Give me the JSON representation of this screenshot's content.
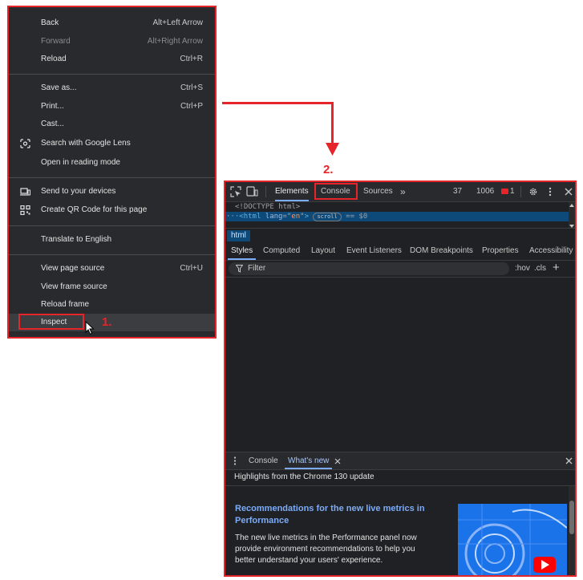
{
  "context_menu": {
    "groups": [
      [
        {
          "label": "Back",
          "shortcut": "Alt+Left Arrow",
          "disabled": false
        },
        {
          "label": "Forward",
          "shortcut": "Alt+Right Arrow",
          "disabled": true
        },
        {
          "label": "Reload",
          "shortcut": "Ctrl+R",
          "disabled": false
        }
      ],
      [
        {
          "label": "Save as...",
          "shortcut": "Ctrl+S",
          "disabled": false
        },
        {
          "label": "Print...",
          "shortcut": "Ctrl+P",
          "disabled": false
        },
        {
          "label": "Cast...",
          "shortcut": "",
          "disabled": false
        },
        {
          "label": "Search with Google Lens",
          "shortcut": "",
          "icon": "google-lens-icon"
        },
        {
          "label": "Open in reading mode",
          "shortcut": ""
        }
      ],
      [
        {
          "label": "Send to your devices",
          "shortcut": "",
          "icon": "devices-icon"
        },
        {
          "label": "Create QR Code for this page",
          "shortcut": "",
          "icon": "qr-code-icon"
        }
      ],
      [
        {
          "label": "Translate to English",
          "shortcut": ""
        }
      ],
      [
        {
          "label": "View page source",
          "shortcut": "Ctrl+U"
        },
        {
          "label": "View frame source",
          "shortcut": ""
        },
        {
          "label": "Reload frame",
          "shortcut": ""
        },
        {
          "label": "Inspect",
          "shortcut": "",
          "highlighted": true
        }
      ]
    ]
  },
  "annotations": {
    "step1": "1.",
    "step2": "2."
  },
  "devtools": {
    "toolbar": {
      "tabs": [
        "Elements",
        "Console",
        "Sources"
      ],
      "more": "»",
      "warnings": "37",
      "messages": "1006",
      "errors": "1"
    },
    "dom": {
      "doctype": "<!DOCTYPE html>",
      "html_tag": "html",
      "lang_attr": "lang",
      "lang_value": "\"en\"",
      "scroll_badge": "scroll",
      "selection": "== $0"
    },
    "breadcrumb": "html",
    "styles_tabs": [
      "Styles",
      "Computed",
      "Layout",
      "Event Listeners",
      "DOM Breakpoints",
      "Properties",
      "Accessibility"
    ],
    "filter": {
      "placeholder": "Filter",
      "hov": ":hov",
      "cls": ".cls",
      "plus": "+"
    },
    "drawer": {
      "tabs": [
        "Console",
        "What's new"
      ],
      "highlights": "Highlights from the Chrome 130 update",
      "title": "Recommendations for the new live metrics in Performance",
      "body": "The new live metrics in the Performance panel now provide environment recommendations to help you better understand your users' experience."
    }
  },
  "colors": {
    "annotation": "#e5252a",
    "accent": "#7cacf8",
    "menu_bg": "#292a2d",
    "devtools_bg": "#202124"
  }
}
